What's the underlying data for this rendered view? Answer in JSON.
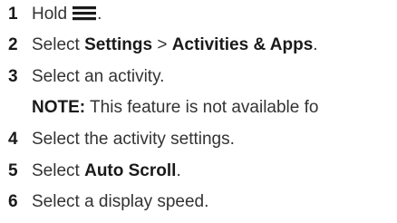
{
  "steps": [
    {
      "number": "1",
      "text": "Hold",
      "icon": "menu-icon",
      "after_icon": "."
    },
    {
      "number": "2",
      "pre": "Select ",
      "b1": "Settings",
      "mid": " > ",
      "b2": "Activities & Apps",
      "post": "."
    },
    {
      "number": "3",
      "text": "Select an activity."
    },
    {
      "note_label": "NOTE:",
      "note_text": " This feature is not available fo"
    },
    {
      "number": "4",
      "text": "Select the activity settings."
    },
    {
      "number": "5",
      "pre": "Select ",
      "b1": "Auto Scroll",
      "post": "."
    },
    {
      "number": "6",
      "text": "Select a display speed."
    }
  ]
}
